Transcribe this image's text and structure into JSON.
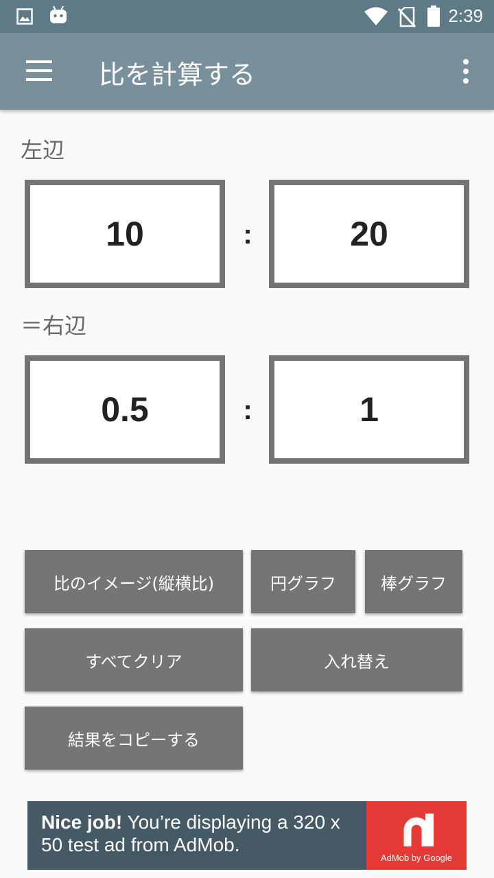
{
  "status_bar": {
    "time": "2:39",
    "icons": [
      "image-icon",
      "android-icon",
      "wifi-icon",
      "no-sim-icon",
      "battery-icon"
    ]
  },
  "app_bar": {
    "title": "比を計算する",
    "menu_icon": "hamburger-menu-icon",
    "overflow_icon": "more-vert-icon"
  },
  "left_side": {
    "label": "左辺",
    "value_a": "10",
    "separator": ":",
    "value_b": "20"
  },
  "right_side": {
    "label": "＝右辺",
    "value_a": "0.5",
    "separator": ":",
    "value_b": "1"
  },
  "buttons": {
    "ratio_image": "比のイメージ(縦横比)",
    "pie_chart": "円グラフ",
    "bar_chart": "棒グラフ",
    "clear_all": "すべてクリア",
    "swap": "入れ替え",
    "copy_result": "結果をコピーする"
  },
  "ad": {
    "headline": "Nice job!",
    "body": " You’re displaying a 320 x 50 test ad from AdMob.",
    "brand": "AdMob by Google"
  },
  "colors": {
    "status_bar": "#5f7a87",
    "app_bar": "#78909c",
    "button": "#757575",
    "box_border": "#747474",
    "ad_background": "#455a64",
    "ad_logo": "#e53935"
  }
}
